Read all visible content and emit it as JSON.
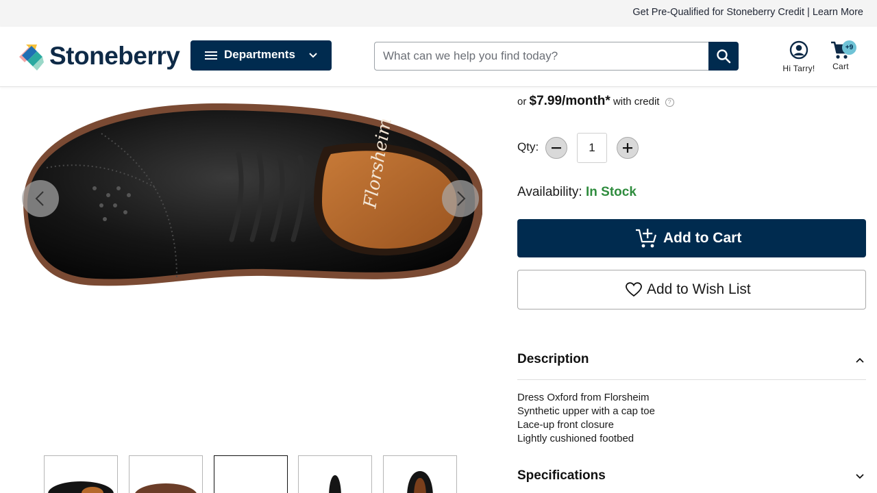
{
  "promo": {
    "text": "Get Pre-Qualified for Stoneberry Credit | Learn More"
  },
  "header": {
    "logo_text": "Stoneberry",
    "departments_label": "Departments",
    "search_placeholder": "What can we help you find today?",
    "account_label": "Hi Tarry!",
    "cart_label": "Cart",
    "cart_badge": "+9"
  },
  "product": {
    "credit": {
      "prefix": "or",
      "monthly_price": "$7.99/month*",
      "suffix": "with credit"
    },
    "quantity": {
      "label": "Qty:",
      "value": "1"
    },
    "availability": {
      "label": "Availability:",
      "status": "In Stock"
    },
    "add_to_cart_label": "Add to Cart",
    "wishlist_label": "Add to Wish List",
    "description": {
      "title": "Description",
      "bullets": [
        "Dress Oxford from Florsheim",
        "Synthetic upper with a cap toe",
        "Lace-up front closure",
        "Lightly cushioned footbed"
      ]
    },
    "specifications": {
      "title": "Specifications"
    },
    "thumbnails": [
      {
        "name": "shoe-top-view"
      },
      {
        "name": "shoe-sole-view"
      },
      {
        "name": "shoe-blank-view"
      },
      {
        "name": "shoe-front-view"
      },
      {
        "name": "shoe-heel-view"
      }
    ]
  },
  "colors": {
    "brand_navy": "#002b4f",
    "in_stock_green": "#2f8c3e",
    "badge_teal": "#6fc3d6"
  },
  "icons": {
    "menu": "menu-icon",
    "chevron": "chevron-down-icon",
    "search": "search-icon",
    "account": "account-icon",
    "cart": "cart-icon",
    "add_cart": "add-cart-icon",
    "heart": "heart-icon",
    "help": "help-icon"
  }
}
